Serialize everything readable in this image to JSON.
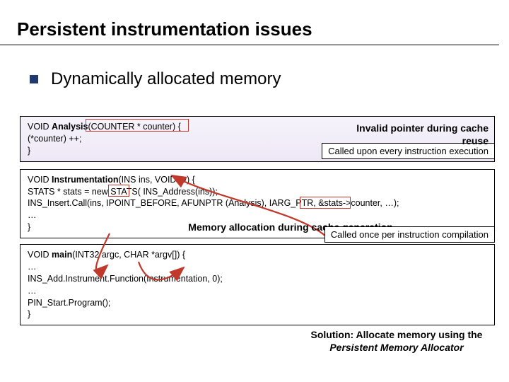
{
  "title": "Persistent instrumentation issues",
  "bullet": "Dynamically allocated memory",
  "callout_top": "Called upon every instruction execution",
  "callout_mid": "Called once per instruction compilation",
  "code1": {
    "l1a": "VOID ",
    "l1b": "Analysis",
    "l1c": "(COUNTER * counter) {",
    "l2": "   (*counter) ++;",
    "l3": "}"
  },
  "annot_invalid": "Invalid pointer during cache reuse",
  "code2": {
    "l1a": "VOID ",
    "l1b": "Instrumentation",
    "l1c": "(INS ins, VOID *v) {",
    "l2": "   STATS * stats = new STATS( INS_Address(ins));",
    "l3": "   INS_Insert.Call(ins, IPOINT_BEFORE, AFUNPTR (Analysis), IARG_PTR, &stats->counter, …);",
    "l4": "   …",
    "l5": "}"
  },
  "annot_memalloc": "Memory allocation during cache generation",
  "code3": {
    "l1a": "VOID ",
    "l1b": "main",
    "l1c": "(INT32 argc, CHAR *argv[]) {",
    "l2": "   …",
    "l3": "   INS_Add.Instrument.Function(Instrumentation, 0);",
    "l4": "   …",
    "l5": "   PIN_Start.Program();",
    "l6": "}"
  },
  "solution_a": "Solution: Allocate memory using the ",
  "solution_b": "Persistent Memory Allocator"
}
